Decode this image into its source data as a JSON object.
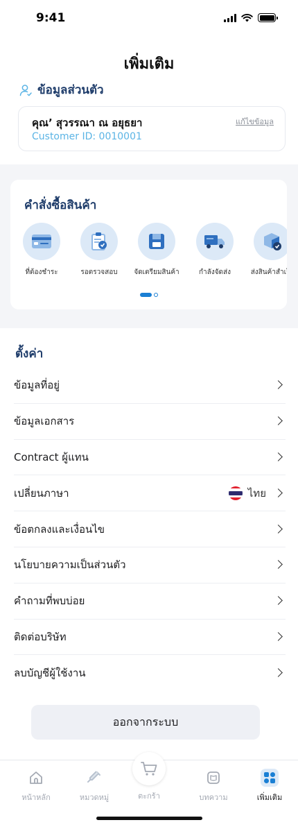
{
  "status_bar": {
    "time": "9:41"
  },
  "page": {
    "title": "เพิ่มเติม"
  },
  "profile": {
    "heading": "ข้อมูลส่วนตัว",
    "name": "คุณ’ สุวรรณา  ณ อยุธยา",
    "customer_id": "Customer ID: 0010001",
    "edit_label": "แก้ไขข้อมูล"
  },
  "orders": {
    "title": "คำสั่งซื้อสินค้า",
    "items": [
      {
        "label": "ที่ต้องชำระ",
        "icon": "credit-card-icon"
      },
      {
        "label": "รอตรวจสอบ",
        "icon": "clipboard-check-icon"
      },
      {
        "label": "จัดเตรียมสินค้า",
        "icon": "package-prepare-icon"
      },
      {
        "label": "กำลังจัดส่ง",
        "icon": "delivery-truck-icon"
      },
      {
        "label": "ส่งสินค้าสำเร็จ",
        "icon": "box-delivered-icon"
      }
    ],
    "page_indicator": {
      "current": 1,
      "total": 2
    }
  },
  "settings": {
    "heading": "ตั้งค่า",
    "items": [
      {
        "label": "ข้อมูลที่อยู่"
      },
      {
        "label": "ข้อมูลเอกสาร"
      },
      {
        "label": "Contract ผู้แทน"
      },
      {
        "label": "เปลี่ยนภาษา",
        "value": "ไทย",
        "value_icon": "thai-flag-icon"
      },
      {
        "label": "ข้อตกลงและเงื่อนไข"
      },
      {
        "label": "นโยบายความเป็นส่วนตัว"
      },
      {
        "label": "คำถามที่พบบ่อย"
      },
      {
        "label": "ติดต่อบริษัท"
      },
      {
        "label": "ลบบัญชีผู้ใช้งาน"
      }
    ]
  },
  "logout_label": "ออกจากระบบ",
  "tabs": [
    {
      "label": "หน้าหลัก",
      "icon": "home-icon",
      "active": false
    },
    {
      "label": "หมวดหมู่",
      "icon": "syringe-icon",
      "active": false
    },
    {
      "label": "ตะกร้า",
      "icon": "cart-icon",
      "active": false
    },
    {
      "label": "บทความ",
      "icon": "book-icon",
      "active": false
    },
    {
      "label": "เพิ่มเติม",
      "icon": "grid-icon",
      "active": true
    }
  ],
  "colors": {
    "brand_navy": "#1f3d6b",
    "accent_blue": "#1a7fd4",
    "id_blue": "#5bb4e5",
    "icon_bg": "#dce9f7"
  }
}
